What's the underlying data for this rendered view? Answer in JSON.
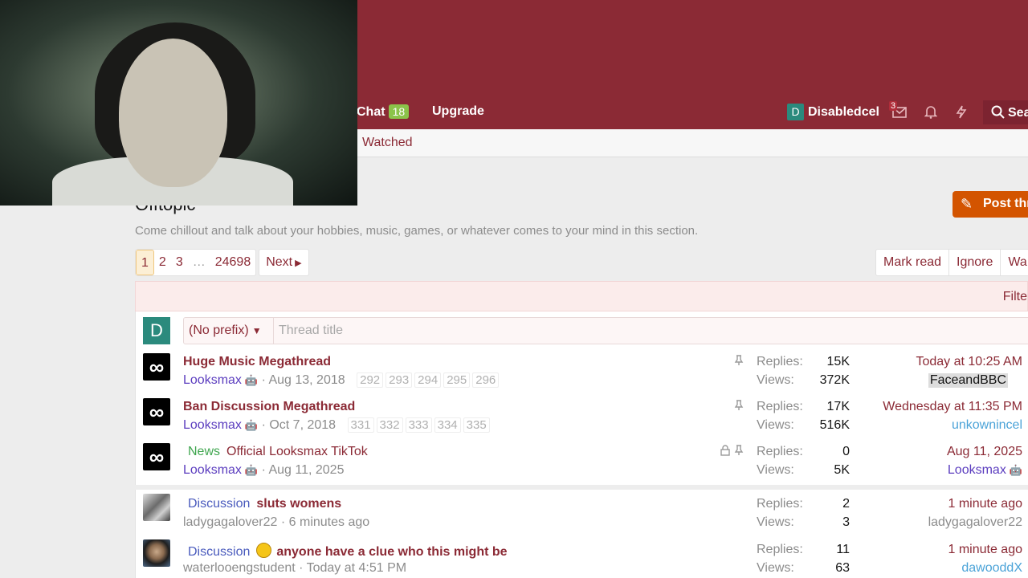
{
  "header": {
    "chat_label": "Chat",
    "chat_count": "18",
    "upgrade_label": "Upgrade",
    "user_initial": "D",
    "user_name": "Disabledcel",
    "inbox_count": "3",
    "search_label": "Sea"
  },
  "subnav": {
    "watched_label": "Watched"
  },
  "forum": {
    "title": "Offtopic",
    "description": "Come chillout and talk about your hobbies, music, games, or whatever comes to your mind in this section.",
    "post_thread_label": "Post thr"
  },
  "pagination": {
    "pages": [
      "1",
      "2",
      "3",
      "…",
      "24698"
    ],
    "next_label": "Next"
  },
  "actions": {
    "mark_read": "Mark read",
    "ignore": "Ignore",
    "watch": "Wa"
  },
  "filter": {
    "label": "Filte"
  },
  "new_thread": {
    "avatar_initial": "D",
    "prefix_label": "(No prefix)",
    "title_placeholder": "Thread title"
  },
  "sticky_threads": [
    {
      "title": "Huge Music Megathread",
      "author": "Looksmax",
      "date": "Aug 13, 2018",
      "pages": [
        "292",
        "293",
        "294",
        "295",
        "296"
      ],
      "replies_label": "Replies:",
      "replies": "15K",
      "views_label": "Views:",
      "views": "372K",
      "last_time": "Today at 10:25 AM",
      "last_user": "FaceandBBC"
    },
    {
      "title": "Ban Discussion Megathread",
      "author": "Looksmax",
      "date": "Oct 7, 2018",
      "pages": [
        "331",
        "332",
        "333",
        "334",
        "335"
      ],
      "replies_label": "Replies:",
      "replies": "17K",
      "views_label": "Views:",
      "views": "516K",
      "last_time": "Wednesday at 11:35 PM",
      "last_user": "unkownincel"
    },
    {
      "prefix": "News",
      "title": "Official Looksmax TikTok",
      "author": "Looksmax",
      "date": "Aug 11, 2025",
      "replies_label": "Replies:",
      "replies": "0",
      "views_label": "Views:",
      "views": "5K",
      "last_time": "Aug 11, 2025",
      "last_user": "Looksmax"
    }
  ],
  "threads": [
    {
      "prefix": "Discussion",
      "title": "sluts womens",
      "author": "ladygagalover22",
      "date": "6 minutes ago",
      "replies_label": "Replies:",
      "replies": "2",
      "views_label": "Views:",
      "views": "3",
      "last_time": "1 minute ago",
      "last_user": "ladygagalover22"
    },
    {
      "prefix": "Discussion",
      "title": "anyone have a clue who this might be",
      "author": "waterlooengstudent",
      "date": "Today at 4:51 PM",
      "replies_label": "Replies:",
      "replies": "11",
      "views_label": "Views:",
      "views": "63",
      "last_time": "1 minute ago",
      "last_user": "dawooddX"
    }
  ],
  "separator": "·",
  "colors": {
    "brand": "#8b2a35",
    "accent_button": "#d35400",
    "badge_green": "#8bc34a"
  }
}
